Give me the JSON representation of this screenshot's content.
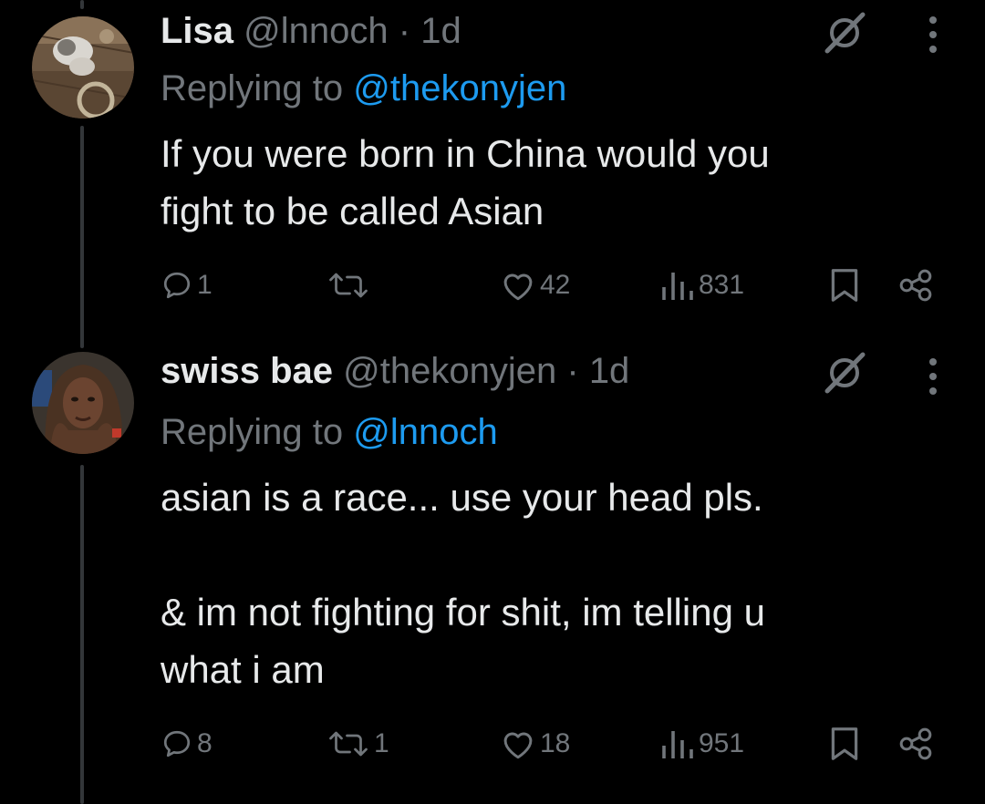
{
  "colors": {
    "background": "#000000",
    "primary_text": "#e7e9ea",
    "secondary_text": "#71767b",
    "mention": "#1d9bf0",
    "thread_line": "#333639"
  },
  "tweets": [
    {
      "author_name": "Lisa",
      "author_handle": "@lnnoch",
      "separator": "·",
      "time": "1d",
      "replying_prefix": "Replying to",
      "replying_to": "@thekonyjen",
      "text": "If you were born in China would you\nfight to be called Asian",
      "avatar_icon": "avatar-cat-photo",
      "replies": "1",
      "retweets": "",
      "likes": "42",
      "views": "831"
    },
    {
      "author_name": "swiss bae",
      "author_handle": "@thekonyjen",
      "separator": "·",
      "time": "1d",
      "replying_prefix": "Replying to",
      "replying_to": "@lnnoch",
      "text": "asian is a race... use your head pls.\n\n& im not fighting for shit, im telling u\nwhat i am",
      "avatar_icon": "avatar-woman-photo",
      "replies": "8",
      "retweets": "1",
      "likes": "18",
      "views": "951"
    }
  ],
  "icons": {
    "reply": "reply-icon",
    "retweet": "retweet-icon",
    "like": "heart-icon",
    "views": "views-icon",
    "bookmark": "bookmark-icon",
    "share": "share-icon",
    "grok": "grok-icon",
    "more": "more-icon"
  }
}
